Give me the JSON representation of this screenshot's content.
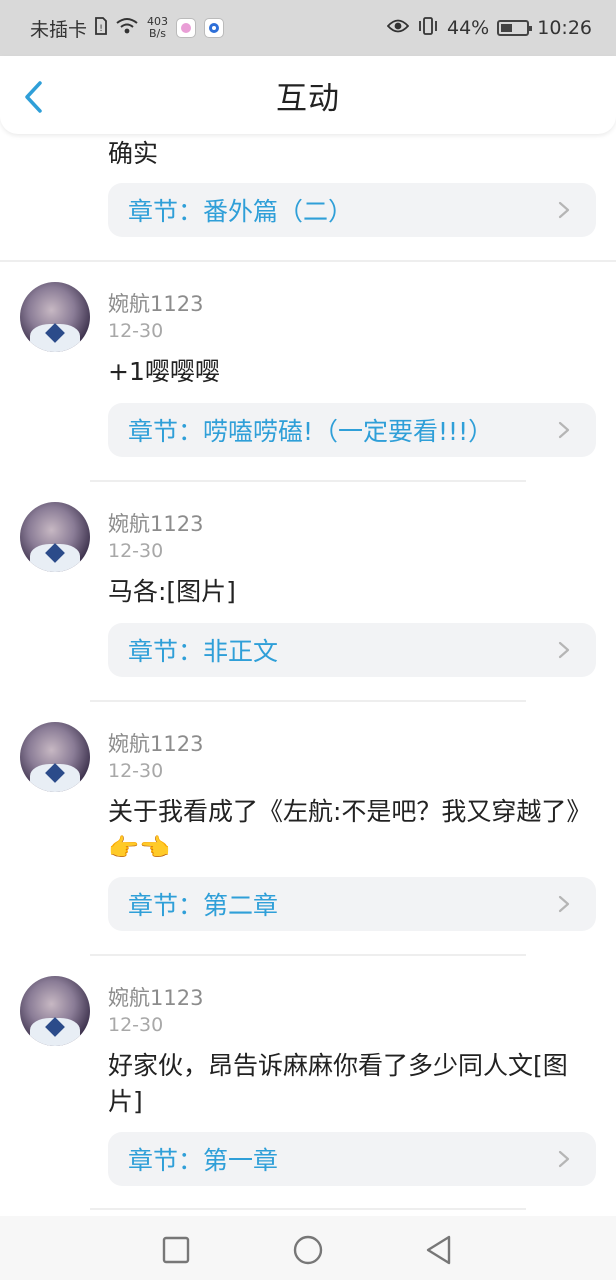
{
  "status_bar": {
    "carrier": "未插卡",
    "speed_value": "403",
    "speed_unit": "B/s",
    "battery": "44%",
    "time": "10:26",
    "battery_level": 0.44
  },
  "header": {
    "title": "互动"
  },
  "top": {
    "comment": "确实",
    "chapter": "章节：番外篇（二）"
  },
  "items": [
    {
      "username": "婉航1123",
      "date": "12-30",
      "comment": "+1嘤嘤嘤",
      "chapter": "章节：唠嗑唠磕!（一定要看!!!）"
    },
    {
      "username": "婉航1123",
      "date": "12-30",
      "comment": "马各:[图片]",
      "chapter": "章节：非正文"
    },
    {
      "username": "婉航1123",
      "date": "12-30",
      "comment": "关于我看成了《左航:不是吧？我又穿越了》👉👈",
      "chapter": "章节：第二章"
    },
    {
      "username": "婉航1123",
      "date": "12-30",
      "comment": "好家伙，昂告诉麻麻你看了多少同人文[图片]",
      "chapter": "章节：第一章"
    }
  ],
  "colors": {
    "accent": "#2f9fd8",
    "chapter_bg": "#f2f3f5",
    "status_bg": "#d9d9d9"
  },
  "icons": {
    "back": "chevron-left-icon",
    "chapter_arrow": "chevron-right-icon",
    "nav_recent": "square-icon",
    "nav_home": "circle-icon",
    "nav_back": "triangle-back-icon"
  }
}
